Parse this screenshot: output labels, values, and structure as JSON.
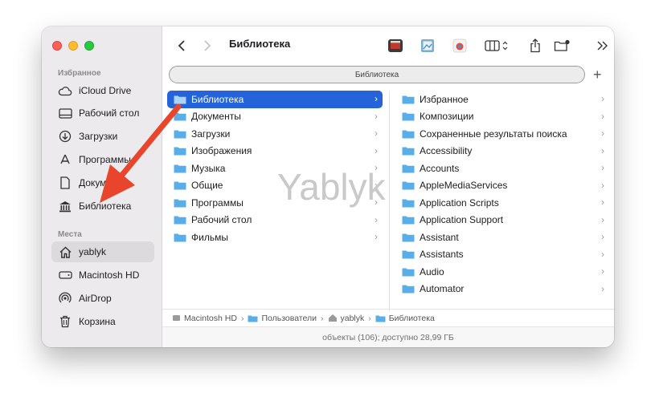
{
  "window": {
    "title": "Библиотека"
  },
  "sidebar": {
    "favorites_header": "Избранное",
    "favorites": [
      {
        "label": "iCloud Drive",
        "icon": "cloud-icon"
      },
      {
        "label": "Рабочий стол",
        "icon": "desktop-icon"
      },
      {
        "label": "Загрузки",
        "icon": "download-icon"
      },
      {
        "label": "Программы",
        "icon": "apps-icon"
      },
      {
        "label": "Документы",
        "icon": "document-icon"
      },
      {
        "label": "Библиотека",
        "icon": "library-icon"
      }
    ],
    "places_header": "Места",
    "places": [
      {
        "label": "yablyk",
        "icon": "home-icon"
      },
      {
        "label": "Macintosh HD",
        "icon": "disk-icon"
      },
      {
        "label": "AirDrop",
        "icon": "airdrop-icon"
      },
      {
        "label": "Корзина",
        "icon": "trash-icon"
      }
    ]
  },
  "pathbar": {
    "label": "Библиотека"
  },
  "column1": [
    "Библиотека",
    "Документы",
    "Загрузки",
    "Изображения",
    "Музыка",
    "Общие",
    "Программы",
    "Рабочий стол",
    "Фильмы"
  ],
  "column2": [
    "Избранное",
    "Композиции",
    "Сохраненные результаты поиска",
    "Accessibility",
    "Accounts",
    "AppleMediaServices",
    "Application Scripts",
    "Application Support",
    "Assistant",
    "Assistants",
    "Audio",
    "Automator"
  ],
  "breadcrumb": [
    "Macintosh HD",
    "Пользователи",
    "yablyk",
    "Библиотека"
  ],
  "status": "объекты (106); доступно 28,99 ГБ",
  "watermark": "Yablyk",
  "colors": {
    "accent": "#2463d9",
    "folder": "#5aaee8",
    "arrow": "#e8452c"
  }
}
